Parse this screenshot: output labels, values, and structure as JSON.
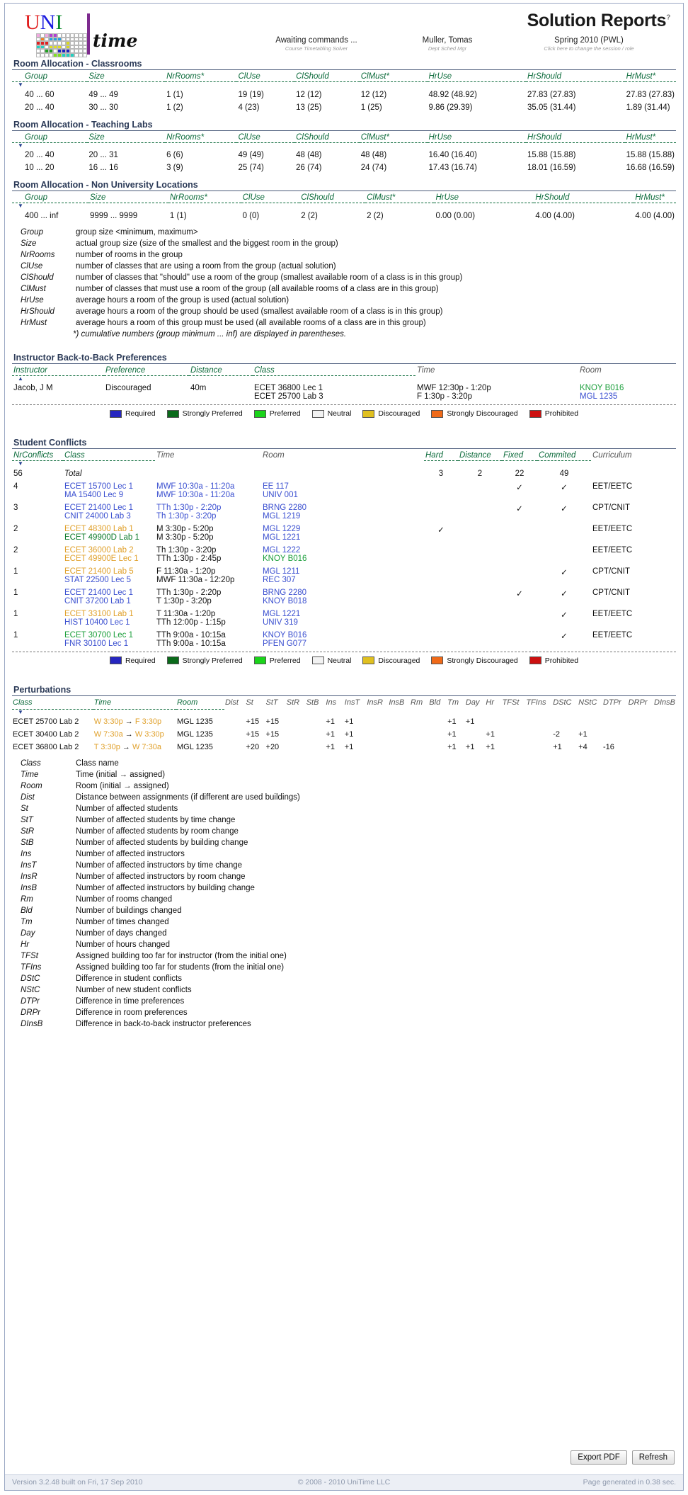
{
  "header": {
    "title": "Solution Reports",
    "title_sup": "?",
    "logo": {
      "uni_u": "U",
      "uni_n": "N",
      "uni_i": "I",
      "time": "time"
    },
    "links": [
      {
        "label": "Awaiting commands ...",
        "sub": "Course Timetabling Solver"
      },
      {
        "label": "Muller, Tomas",
        "sub": "Dept Sched Mgr"
      },
      {
        "label": "Spring 2010 (PWL)",
        "sub": "Click here to change the session / role"
      }
    ]
  },
  "room_allocation": {
    "columns": [
      "Group",
      "Size",
      "NrRooms*",
      "ClUse",
      "ClShould",
      "ClMust*",
      "HrUse",
      "HrShould",
      "HrMust*"
    ],
    "sections": [
      {
        "title": "Room Allocation - Classrooms",
        "rows": [
          [
            "40 ... 60",
            "49 ... 49",
            "1 (1)",
            "19 (19)",
            "12 (12)",
            "12 (12)",
            "48.92 (48.92)",
            "27.83 (27.83)",
            "27.83 (27.83)"
          ],
          [
            "20 ... 40",
            "30 ... 30",
            "1 (2)",
            "4 (23)",
            "13 (25)",
            "1 (25)",
            "9.86 (29.39)",
            "35.05 (31.44)",
            "1.89 (31.44)"
          ]
        ]
      },
      {
        "title": "Room Allocation - Teaching Labs",
        "rows": [
          [
            "20 ... 40",
            "20 ... 31",
            "6 (6)",
            "49 (49)",
            "48 (48)",
            "48 (48)",
            "16.40 (16.40)",
            "15.88 (15.88)",
            "15.88 (15.88)"
          ],
          [
            "10 ... 20",
            "16 ... 16",
            "3 (9)",
            "25 (74)",
            "26 (74)",
            "24 (74)",
            "17.43 (16.74)",
            "18.01 (16.59)",
            "16.68 (16.59)"
          ]
        ]
      },
      {
        "title": "Room Allocation - Non University Locations",
        "rows": [
          [
            "400 ... inf",
            "9999 ... 9999",
            "1 (1)",
            "0 (0)",
            "2 (2)",
            "2 (2)",
            "0.00 (0.00)",
            "4.00 (4.00)",
            "4.00 (4.00)"
          ]
        ]
      }
    ],
    "glossary": [
      [
        "Group",
        "group size <minimum, maximum>"
      ],
      [
        "Size",
        "actual group size (size of the smallest and the biggest room in the group)"
      ],
      [
        "NrRooms",
        "number of rooms in the group"
      ],
      [
        "ClUse",
        "number of classes that are using a room from the group (actual solution)"
      ],
      [
        "ClShould",
        "number of classes that \"should\" use a room of the group (smallest available room of a class is in this group)"
      ],
      [
        "ClMust",
        "number of classes that must use a room of the group (all available rooms of a class are in this group)"
      ],
      [
        "HrUse",
        "average hours a room of the group is used (actual solution)"
      ],
      [
        "HrShould",
        "average hours a room of the group should be used (smallest available room of a class is in this group)"
      ],
      [
        "HrMust",
        "average hours a room of this group must be used (all available rooms of a class are in this group)"
      ]
    ],
    "footnote": "*) cumulative numbers (group minimum ... inf) are displayed in parentheses."
  },
  "instructor_b2b": {
    "title": "Instructor Back-to-Back Preferences",
    "columns": [
      "Instructor",
      "Preference",
      "Distance",
      "Class",
      "Time",
      "Room"
    ],
    "rows": [
      {
        "instructor": "Jacob, J M",
        "preference": "Discouraged",
        "distance": "40m",
        "classes": [
          "ECET 36800 Lec 1",
          "ECET 25700 Lab 3"
        ],
        "times": [
          "MWF 12:30p - 1:20p",
          "F 1:30p - 3:20p"
        ],
        "rooms": [
          "KNOY B016",
          "MGL 1235"
        ]
      }
    ]
  },
  "legend": [
    {
      "label": "Required",
      "color": "#2626c0"
    },
    {
      "label": "Strongly Preferred",
      "color": "#0a6a1a"
    },
    {
      "label": "Preferred",
      "color": "#1ad41a"
    },
    {
      "label": "Neutral",
      "color": "#f2f2f2"
    },
    {
      "label": "Discouraged",
      "color": "#e0c020"
    },
    {
      "label": "Strongly Discouraged",
      "color": "#f06a18"
    },
    {
      "label": "Prohibited",
      "color": "#cc1010"
    }
  ],
  "student_conflicts": {
    "title": "Student Conflicts",
    "columns": [
      "NrConflicts",
      "Class",
      "Time",
      "Room",
      "Hard",
      "Distance",
      "Fixed",
      "Commited",
      "Curriculum"
    ],
    "rows": [
      {
        "nr": "56",
        "classes": [
          "Total"
        ],
        "times": [
          ""
        ],
        "rooms": [
          ""
        ],
        "hard": "3",
        "distance": "2",
        "fixed": "22",
        "commited": "49",
        "curriculum": "",
        "total": true
      },
      {
        "nr": "4",
        "classes": [
          "ECET 15700 Lec 1",
          "MA 15400 Lec 9"
        ],
        "class_colors": [
          "blue",
          "blue"
        ],
        "times": [
          "MWF 10:30a - 11:20a",
          "MWF 10:30a - 11:20a"
        ],
        "rooms": [
          "EE 117",
          "UNIV 001"
        ],
        "room_colors": [
          "blue",
          "blue"
        ],
        "hard": "",
        "distance": "",
        "fixed": "check",
        "commited": "check",
        "curriculum": "EET/EETC"
      },
      {
        "nr": "3",
        "classes": [
          "ECET 21400 Lec 1",
          "CNIT 24000 Lab 3"
        ],
        "class_colors": [
          "blue",
          "blue"
        ],
        "times": [
          "TTh 1:30p - 2:20p",
          "Th 1:30p - 3:20p"
        ],
        "rooms": [
          "BRNG 2280",
          "MGL 1219"
        ],
        "room_colors": [
          "blue",
          "blue"
        ],
        "hard": "",
        "distance": "",
        "fixed": "check",
        "commited": "check",
        "curriculum": "CPT/CNIT"
      },
      {
        "nr": "2",
        "classes": [
          "ECET 48300 Lab 1",
          "ECET 49900D Lab 1"
        ],
        "class_colors": [
          "orange",
          "dgreen"
        ],
        "times": [
          "M 3:30p - 5:20p",
          "M 3:30p - 5:20p"
        ],
        "rooms": [
          "MGL 1229",
          "MGL 1221"
        ],
        "room_colors": [
          "blue",
          "blue"
        ],
        "hard": "check",
        "distance": "",
        "fixed": "",
        "commited": "",
        "curriculum": "EET/EETC"
      },
      {
        "nr": "2",
        "classes": [
          "ECET 36000 Lab 2",
          "ECET 49900E Lec 1"
        ],
        "class_colors": [
          "orange",
          "orange"
        ],
        "times": [
          "Th 1:30p - 3:20p",
          "TTh 1:30p - 2:45p"
        ],
        "rooms": [
          "MGL 1222",
          "KNOY B016"
        ],
        "room_colors": [
          "blue",
          "green"
        ],
        "hard": "",
        "distance": "",
        "fixed": "",
        "commited": "",
        "curriculum": "EET/EETC"
      },
      {
        "nr": "1",
        "classes": [
          "ECET 21400 Lab 5",
          "STAT 22500 Lec 5"
        ],
        "class_colors": [
          "orange",
          "blue"
        ],
        "times": [
          "F 11:30a - 1:20p",
          "MWF 11:30a - 12:20p"
        ],
        "rooms": [
          "MGL 1211",
          "REC 307"
        ],
        "room_colors": [
          "blue",
          "blue"
        ],
        "hard": "",
        "distance": "",
        "fixed": "",
        "commited": "check",
        "curriculum": "CPT/CNIT"
      },
      {
        "nr": "1",
        "classes": [
          "ECET 21400 Lec 1",
          "CNIT 37200 Lab 1"
        ],
        "class_colors": [
          "blue",
          "blue"
        ],
        "times": [
          "TTh 1:30p - 2:20p",
          "T 1:30p - 3:20p"
        ],
        "rooms": [
          "BRNG 2280",
          "KNOY B018"
        ],
        "room_colors": [
          "blue",
          "blue"
        ],
        "hard": "",
        "distance": "",
        "fixed": "check",
        "commited": "check",
        "curriculum": "CPT/CNIT"
      },
      {
        "nr": "1",
        "classes": [
          "ECET 33100 Lab 1",
          "HIST 10400 Lec 1"
        ],
        "class_colors": [
          "orange",
          "blue"
        ],
        "times": [
          "T 11:30a - 1:20p",
          "TTh 12:00p - 1:15p"
        ],
        "rooms": [
          "MGL 1221",
          "UNIV 319"
        ],
        "room_colors": [
          "blue",
          "blue"
        ],
        "hard": "",
        "distance": "",
        "fixed": "",
        "commited": "check",
        "curriculum": "EET/EETC"
      },
      {
        "nr": "1",
        "classes": [
          "ECET 30700 Lec 1",
          "FNR 30100 Lec 1"
        ],
        "class_colors": [
          "green",
          "blue"
        ],
        "times": [
          "TTh 9:00a - 10:15a",
          "TTh 9:00a - 10:15a"
        ],
        "rooms": [
          "KNOY B016",
          "PFEN G077"
        ],
        "room_colors": [
          "blue",
          "blue"
        ],
        "hard": "",
        "distance": "",
        "fixed": "",
        "commited": "check",
        "curriculum": "EET/EETC"
      }
    ]
  },
  "perturbations": {
    "title": "Perturbations",
    "columns": [
      "Class",
      "Time",
      "Room",
      "Dist",
      "St",
      "StT",
      "StR",
      "StB",
      "Ins",
      "InsT",
      "InsR",
      "InsB",
      "Rm",
      "Bld",
      "Tm",
      "Day",
      "Hr",
      "TFSt",
      "TFIns",
      "DStC",
      "NStC",
      "DTPr",
      "DRPr",
      "DInsB"
    ],
    "rows": [
      {
        "class": "ECET 25700 Lab 2",
        "time_from": "W 3:30p",
        "time_arrow": "→",
        "time_to": "F 3:30p",
        "room": "MGL 1235",
        "dist": "",
        "st": "+15",
        "stt": "+15",
        "str": "",
        "stb": "",
        "ins": "+1",
        "inst": "+1",
        "insr": "",
        "insb": "",
        "rm": "",
        "bld": "",
        "tm": "+1",
        "day": "+1",
        "hr": "",
        "tfst": "",
        "tfins": "",
        "dstc": "",
        "nstc": "",
        "dtpr": "",
        "drpr": "",
        "dinsb": ""
      },
      {
        "class": "ECET 30400 Lab 2",
        "time_from": "W 7:30a",
        "time_arrow": "→",
        "time_to": "W 3:30p",
        "room": "MGL 1235",
        "dist": "",
        "st": "+15",
        "stt": "+15",
        "str": "",
        "stb": "",
        "ins": "+1",
        "inst": "+1",
        "insr": "",
        "insb": "",
        "rm": "",
        "bld": "",
        "tm": "+1",
        "day": "",
        "hr": "+1",
        "tfst": "",
        "tfins": "",
        "dstc": "-2",
        "nstc": "+1",
        "dtpr": "",
        "drpr": "",
        "dinsb": ""
      },
      {
        "class": "ECET 36800 Lab 2",
        "time_from": "T 3:30p",
        "time_arrow": "→",
        "time_to": "W 7:30a",
        "room": "MGL 1235",
        "dist": "",
        "st": "+20",
        "stt": "+20",
        "str": "",
        "stb": "",
        "ins": "+1",
        "inst": "+1",
        "insr": "",
        "insb": "",
        "rm": "",
        "bld": "",
        "tm": "+1",
        "day": "+1",
        "hr": "+1",
        "tfst": "",
        "tfins": "",
        "dstc": "+1",
        "nstc": "+4",
        "dtpr": "-16",
        "drpr": "",
        "dinsb": ""
      }
    ],
    "glossary": [
      [
        "Class",
        "Class name"
      ],
      [
        "Time",
        "Time (initial → assigned)"
      ],
      [
        "Room",
        "Room (initial → assigned)"
      ],
      [
        "Dist",
        "Distance between assignments (if different are used buildings)"
      ],
      [
        "St",
        "Number of affected students"
      ],
      [
        "StT",
        "Number of affected students by time change"
      ],
      [
        "StR",
        "Number of affected students by room change"
      ],
      [
        "StB",
        "Number of affected students by building change"
      ],
      [
        "Ins",
        "Number of affected instructors"
      ],
      [
        "InsT",
        "Number of affected instructors by time change"
      ],
      [
        "InsR",
        "Number of affected instructors by room change"
      ],
      [
        "InsB",
        "Number of affected instructors by building change"
      ],
      [
        "Rm",
        "Number of rooms changed"
      ],
      [
        "Bld",
        "Number of buildings changed"
      ],
      [
        "Tm",
        "Number of times changed"
      ],
      [
        "Day",
        "Number of days changed"
      ],
      [
        "Hr",
        "Number of hours changed"
      ],
      [
        "TFSt",
        "Assigned building too far for instructor (from the initial one)"
      ],
      [
        "TFIns",
        "Assigned building too far for students (from the initial one)"
      ],
      [
        "DStC",
        "Difference in student conflicts"
      ],
      [
        "NStC",
        "Number of new student conflicts"
      ],
      [
        "DTPr",
        "Difference in time preferences"
      ],
      [
        "DRPr",
        "Difference in room preferences"
      ],
      [
        "DInsB",
        "Difference in back-to-back instructor preferences"
      ]
    ]
  },
  "buttons": {
    "export": "Export PDF",
    "refresh": "Refresh"
  },
  "footer": {
    "version": "Version 3.2.48 built on Fri, 17 Sep 2010",
    "copyright": "© 2008 - 2010 UniTime LLC",
    "generated": "Page generated in 0.38 sec."
  }
}
